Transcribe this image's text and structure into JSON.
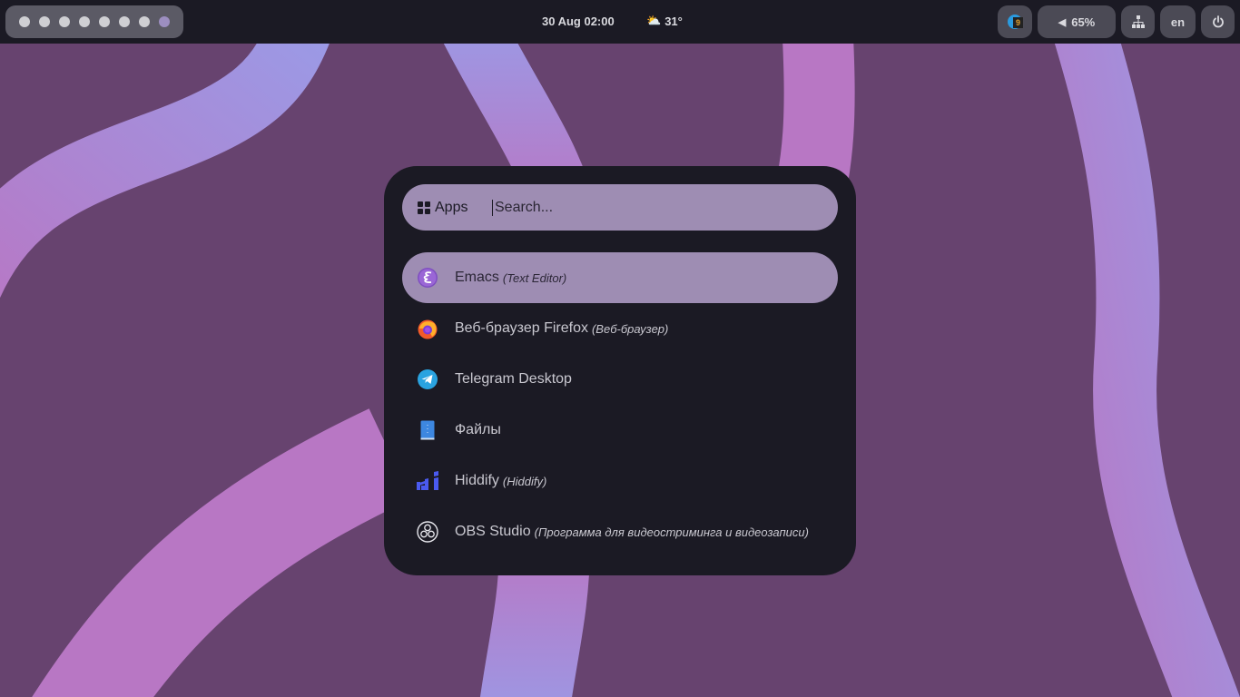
{
  "colors": {
    "wallpaper": "#67436f",
    "stripe_pink": "#b877c4",
    "stripe_lavender": "#9b9ae6",
    "bar": "#1b1a24",
    "accent": "#9e8db3"
  },
  "topbar": {
    "workspaces": {
      "count": 8,
      "active_index": 7
    },
    "clock": "30 Aug 02:00",
    "weather": {
      "icon": "partly-cloudy-icon",
      "glyph": "⛅",
      "temp": "31°"
    },
    "tray": {
      "app_badge": "9",
      "volume": "65%",
      "network_icon": "network-icon",
      "language": "en",
      "power_icon": "power-icon"
    }
  },
  "launcher": {
    "mode_label": "Apps",
    "search": {
      "value": "",
      "placeholder": "Search..."
    },
    "items": [
      {
        "name": "Emacs",
        "desc": "(Text Editor)",
        "icon": "emacs-icon",
        "selected": true
      },
      {
        "name": "Веб-браузер Firefox",
        "desc": "(Веб-браузер)",
        "icon": "firefox-icon"
      },
      {
        "name": "Telegram Desktop",
        "desc": "",
        "icon": "telegram-icon"
      },
      {
        "name": "Файлы",
        "desc": "",
        "icon": "files-icon"
      },
      {
        "name": "Hiddify",
        "desc": "(Hiddify)",
        "icon": "hiddify-icon"
      },
      {
        "name": "OBS Studio",
        "desc": "(Программа для видеостриминга и видеозаписи)",
        "icon": "obs-icon"
      }
    ]
  }
}
